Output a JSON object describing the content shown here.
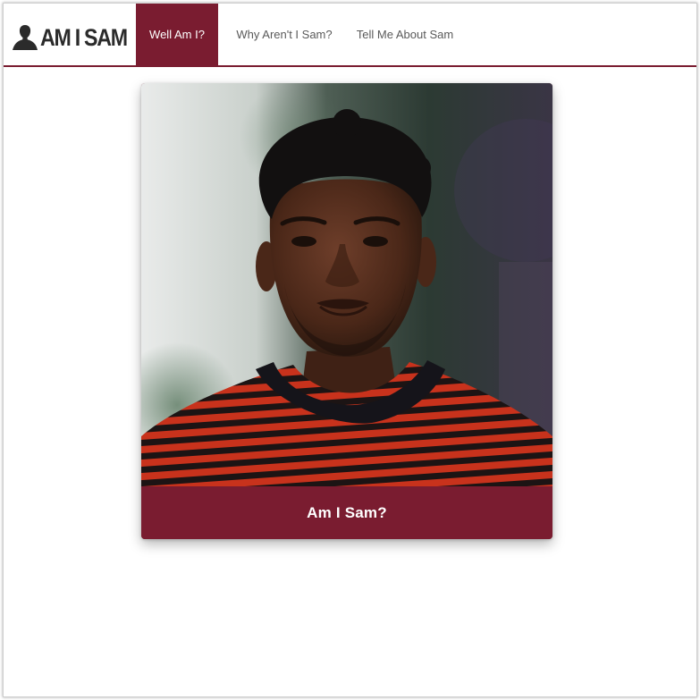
{
  "brand": {
    "logo_text": "AM I SAM",
    "logo_icon": "person-silhouette-icon"
  },
  "nav": {
    "items": [
      {
        "label": "Well Am I?",
        "active": true
      },
      {
        "label": "Why Aren't I Sam?",
        "active": false
      },
      {
        "label": "Tell Me About Sam",
        "active": false
      }
    ]
  },
  "card": {
    "photo_subject": "portrait-photo",
    "button_label": "Am I Sam?"
  },
  "colors": {
    "accent": "#7a1c30",
    "nav_text": "#5a5a5a",
    "logo_text": "#2b2b2b"
  }
}
